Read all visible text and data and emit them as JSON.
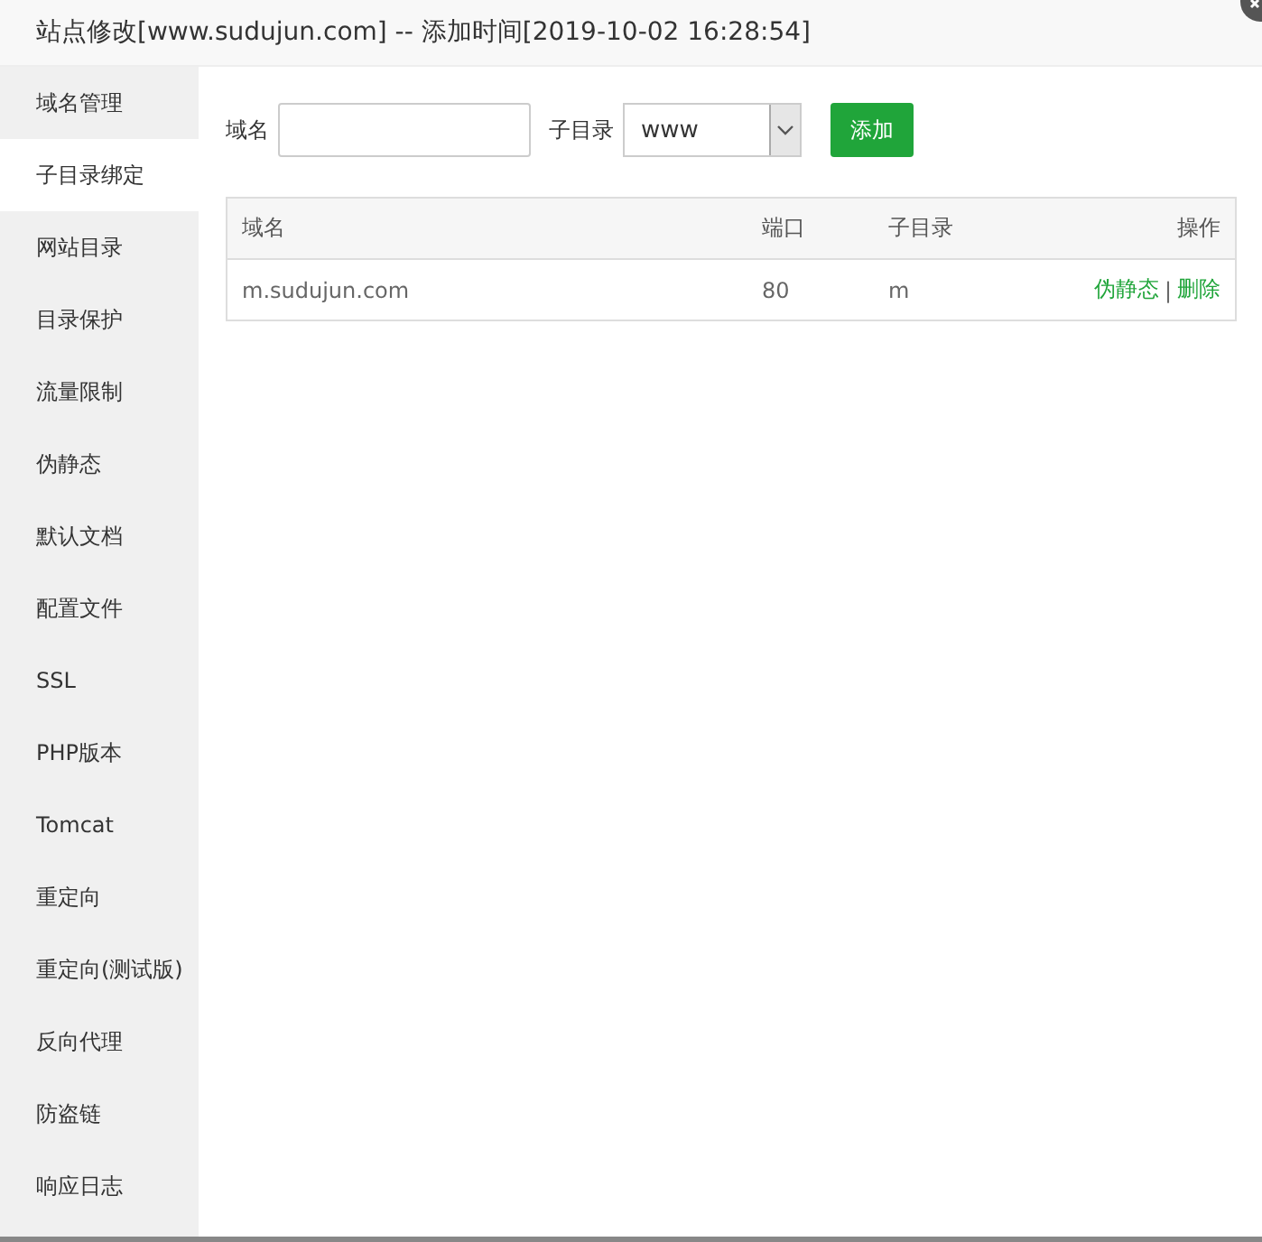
{
  "window": {
    "title": "站点修改[www.sudujun.com] -- 添加时间[2019-10-02 16:28:54]"
  },
  "sidebar": {
    "items": [
      {
        "label": "域名管理",
        "selected": false
      },
      {
        "label": "子目录绑定",
        "selected": true
      },
      {
        "label": "网站目录",
        "selected": false
      },
      {
        "label": "目录保护",
        "selected": false
      },
      {
        "label": "流量限制",
        "selected": false
      },
      {
        "label": "伪静态",
        "selected": false
      },
      {
        "label": "默认文档",
        "selected": false
      },
      {
        "label": "配置文件",
        "selected": false
      },
      {
        "label": "SSL",
        "selected": false
      },
      {
        "label": "PHP版本",
        "selected": false
      },
      {
        "label": "Tomcat",
        "selected": false
      },
      {
        "label": "重定向",
        "selected": false
      },
      {
        "label": "重定向(测试版)",
        "selected": false
      },
      {
        "label": "反向代理",
        "selected": false
      },
      {
        "label": "防盗链",
        "selected": false
      },
      {
        "label": "响应日志",
        "selected": false
      }
    ]
  },
  "form": {
    "domain_label": "域名",
    "subdir_label": "子目录",
    "subdir_value": "www",
    "add_button": "添加"
  },
  "table": {
    "columns": [
      "域名",
      "端口",
      "子目录",
      "操作"
    ],
    "rows": [
      {
        "domain": "m.sudujun.com",
        "port": "80",
        "subdir": "m",
        "actions": [
          "伪静态",
          "删除"
        ],
        "separator": "|"
      }
    ]
  }
}
